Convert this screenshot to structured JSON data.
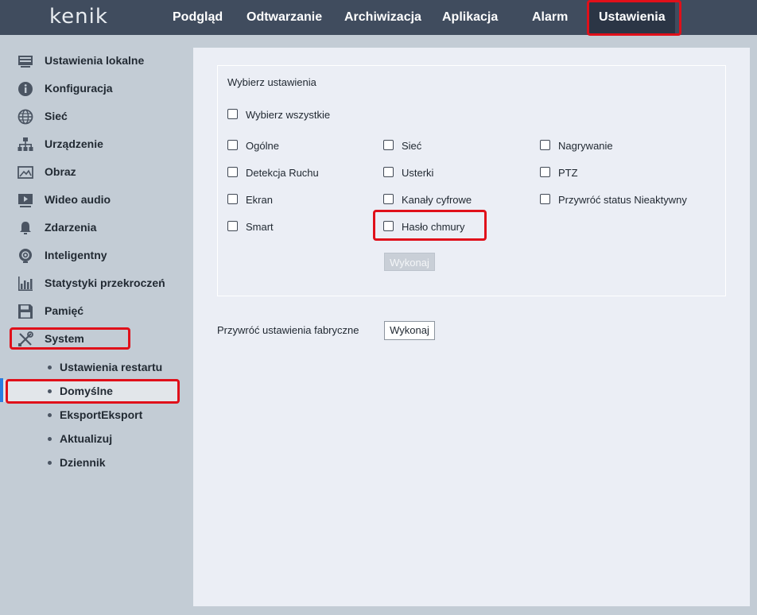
{
  "logo": "kenik",
  "nav": [
    {
      "label": "Podgląd"
    },
    {
      "label": "Odtwarzanie"
    },
    {
      "label": "Archiwizacja"
    },
    {
      "label": "Aplikacja"
    },
    {
      "label": "Alarm"
    },
    {
      "label": "Ustawienia",
      "active": true
    }
  ],
  "sidebar": {
    "items": [
      {
        "label": "Ustawienia lokalne",
        "icon": "monitor-icon"
      },
      {
        "label": "Konfiguracja",
        "icon": "info-icon"
      },
      {
        "label": "Sieć",
        "icon": "globe-icon"
      },
      {
        "label": "Urządzenie",
        "icon": "device-tree-icon"
      },
      {
        "label": "Obraz",
        "icon": "image-icon"
      },
      {
        "label": "Wideo audio",
        "icon": "video-icon"
      },
      {
        "label": "Zdarzenia",
        "icon": "bell-icon"
      },
      {
        "label": "Inteligentny",
        "icon": "brain-icon"
      },
      {
        "label": "Statystyki przekroczeń",
        "icon": "bar-chart-icon"
      },
      {
        "label": "Pamięć",
        "icon": "floppy-icon"
      },
      {
        "label": "System",
        "icon": "tools-icon"
      }
    ],
    "sub_items": [
      {
        "label": "Ustawienia restartu"
      },
      {
        "label": "Domyślne",
        "selected": true
      },
      {
        "label": "EksportEksport"
      },
      {
        "label": "Aktualizuj"
      },
      {
        "label": "Dziennik"
      }
    ]
  },
  "panel": {
    "title": "Wybierz ustawienia",
    "select_all": "Wybierz wszystkie",
    "options": [
      "Ogólne",
      "Sieć",
      "Nagrywanie",
      "Detekcja Ruchu",
      "Usterki",
      "PTZ",
      "Ekran",
      "Kanały cyfrowe",
      "Przywróć status Nieaktywny",
      "Smart",
      "Hasło chmury"
    ],
    "apply_label": "Wykonaj"
  },
  "factory": {
    "label": "Przywróć ustawienia fabryczne",
    "button": "Wykonaj"
  },
  "colors": {
    "topbar": "#404c5e",
    "sidebar": "#c3ccd5",
    "content": "#ebeef5",
    "highlight": "#e0101a"
  }
}
